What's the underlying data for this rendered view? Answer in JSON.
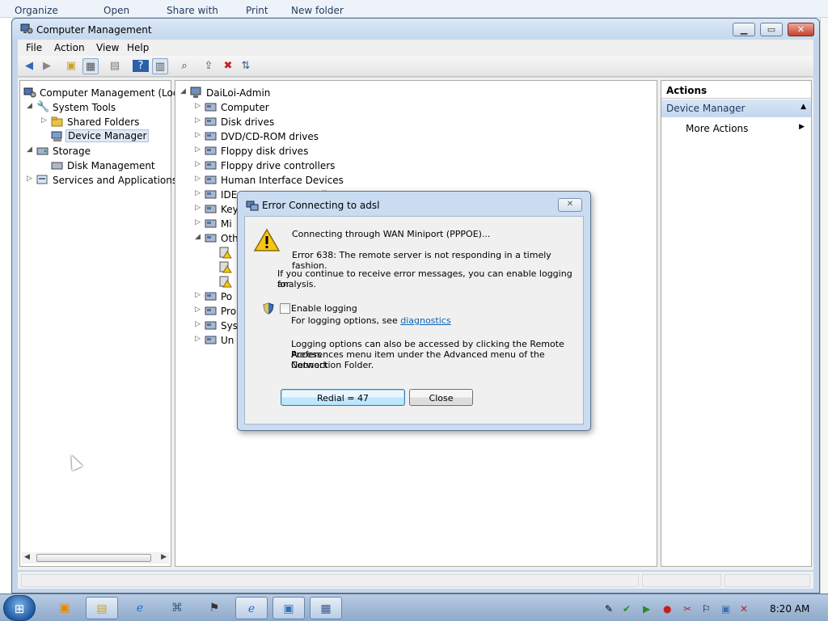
{
  "explorer_bar": {
    "items": [
      "Organize",
      "Open",
      "Share with",
      "Print",
      "New folder"
    ]
  },
  "window": {
    "title": "Computer Management",
    "menu": [
      "File",
      "Action",
      "View",
      "Help"
    ]
  },
  "left_tree": [
    {
      "label": "Computer Management (Local",
      "level": 0,
      "arrow": ""
    },
    {
      "label": "System Tools",
      "level": 1,
      "arrow": "◢"
    },
    {
      "label": "Shared Folders",
      "level": 2,
      "arrow": "▷"
    },
    {
      "label": "Device Manager",
      "level": 2,
      "arrow": "",
      "selected": true
    },
    {
      "label": "Storage",
      "level": 1,
      "arrow": "◢"
    },
    {
      "label": "Disk Management",
      "level": 2,
      "arrow": ""
    },
    {
      "label": "Services and Applications",
      "level": 1,
      "arrow": "▷"
    }
  ],
  "device_tree": {
    "root": "DaiLoi-Admin",
    "items": [
      {
        "label": "Computer",
        "arrow": "▷"
      },
      {
        "label": "Disk drives",
        "arrow": "▷"
      },
      {
        "label": "DVD/CD-ROM drives",
        "arrow": "▷"
      },
      {
        "label": "Floppy disk drives",
        "arrow": "▷"
      },
      {
        "label": "Floppy drive controllers",
        "arrow": "▷"
      },
      {
        "label": "Human Interface Devices",
        "arrow": "▷"
      },
      {
        "label": "IDE ATA/ATAPI controllers",
        "arrow": "▷"
      },
      {
        "label": "Key",
        "arrow": "▷"
      },
      {
        "label": "Mi",
        "arrow": "▷"
      },
      {
        "label": "Oth",
        "arrow": "◢"
      },
      {
        "label": "",
        "arrow": "",
        "indent": true
      },
      {
        "label": "",
        "arrow": "",
        "indent": true
      },
      {
        "label": "",
        "arrow": "",
        "indent": true
      },
      {
        "label": "Po",
        "arrow": "▷"
      },
      {
        "label": "Pro",
        "arrow": "▷"
      },
      {
        "label": "Sys",
        "arrow": "▷"
      },
      {
        "label": "Un",
        "arrow": "▷"
      }
    ]
  },
  "actions": {
    "header": "Actions",
    "group": "Device Manager",
    "item": "More Actions"
  },
  "dialog": {
    "title": "Error Connecting to adsl",
    "connecting": "Connecting through WAN Miniport (PPPOE)...",
    "error": "Error 638: The remote server is not responding in a timely fashion.",
    "continue_msg_line1": "If you continue to receive error messages, you can enable logging for",
    "continue_msg_line2": "analysis.",
    "enable_logging": "Enable logging",
    "logging_options_prefix": "For logging options, see ",
    "logging_options_link": "diagnostics",
    "access_line1": "Logging options can also be accessed by clicking the Remote Access",
    "access_line2": "Preferences menu item under the Advanced menu of the Network",
    "access_line3": "Connection Folder.",
    "redial_button": "Redial = 47",
    "close_button": "Close",
    "enable_logging_checked": false
  },
  "taskbar": {
    "clock": "8:20 AM"
  },
  "colors": {
    "window_frame": "#c4d6ec",
    "selection": "#dfe9f6",
    "link": "#0a64b4",
    "close_red": "#c5412b"
  }
}
